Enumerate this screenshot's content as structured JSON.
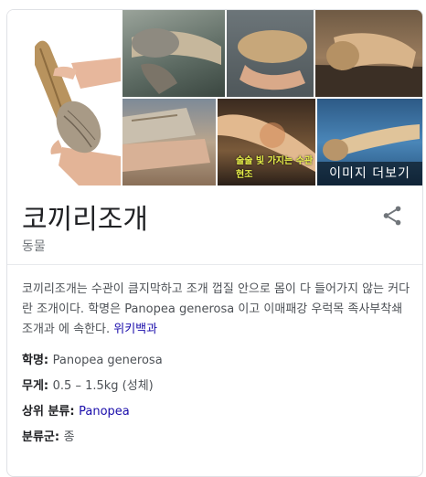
{
  "gallery": {
    "more_images_label": "이미지 더보기",
    "tile5_caption": "술술 빛 가지는 수관 현조"
  },
  "title": "코끼리조개",
  "subtitle": "동물",
  "description": {
    "text": "코끼리조개는 수관이 큼지막하고 조개 껍질 안으로 몸이 다 들어가지 않는 커다란 조개이다. 학명은 Panopea generosa 이고 이매패강 우럭목 족사부착쇄조개과 에 속한다.",
    "source_link": "위키백과"
  },
  "facts": [
    {
      "label": "학명",
      "value": "Panopea generosa",
      "is_link": false
    },
    {
      "label": "무게",
      "value": "0.5 – 1.5kg (성체)",
      "is_link": false
    },
    {
      "label": "상위 분류",
      "value": "Panopea",
      "is_link": true
    },
    {
      "label": "분류군",
      "value": "종",
      "is_link": false
    }
  ],
  "icons": {
    "share": "share-icon"
  },
  "colors": {
    "link": "#1a0dab",
    "title": "#202124",
    "muted": "#70757a"
  }
}
